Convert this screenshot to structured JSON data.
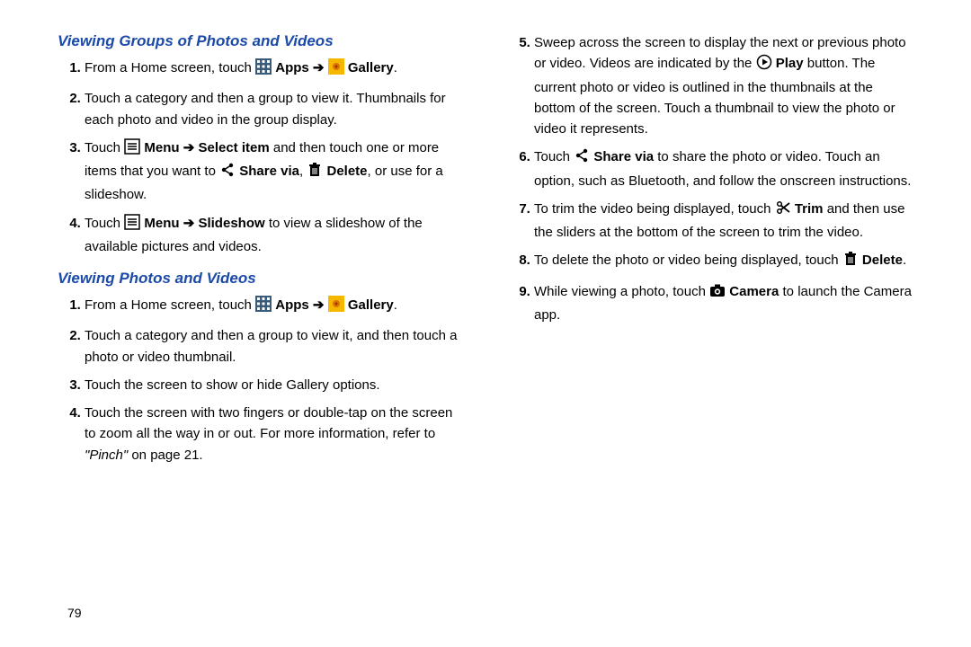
{
  "pageNumber": "79",
  "col1": {
    "heading1": "Viewing Groups of Photos and Videos",
    "s1_i1_a": "From a Home screen, touch ",
    "apps": "Apps",
    "arrow": " ➔ ",
    "gallery": "Gallery",
    "period": ".",
    "s1_i2": "Touch a category and then a group to view it. Thumbnails for each photo and video in the group display.",
    "s1_i3_a": "Touch ",
    "menu": "Menu",
    "select_item": "Select item",
    "s1_i3_b": " and then touch one or more items that you want to ",
    "share_via": "Share via",
    "comma_sp": ", ",
    "delete": "Delete",
    "s1_i3_c": ", or use for a slideshow.",
    "slideshow": "Slideshow",
    "s1_i4_b": " to view a slideshow of the available pictures and videos.",
    "heading2": "Viewing Photos and Videos",
    "s2_i2": "Touch a category and then a group to view it, and then touch a photo or video thumbnail.",
    "s2_i3": "Touch the screen to show or hide Gallery options.",
    "s2_i4_a": "Touch the screen with two fingers or double-tap on the screen to zoom all the way in or out. For more information, refer to ",
    "s2_i4_ref": "\"Pinch\"",
    "s2_i4_b": " on page 21."
  },
  "col2": {
    "i5_a": "Sweep across the screen to display the next or previous photo or video. Videos are indicated by the ",
    "play": "Play",
    "i5_b": " button. The current photo or video is outlined in the thumbnails at the bottom of the screen. Touch a thumbnail to view the photo or video it represents.",
    "i6_a": "Touch ",
    "share_via": "Share via",
    "i6_b": " to share the photo or video. Touch an option, such as Bluetooth, and follow the onscreen instructions.",
    "i7_a": "To trim the video being displayed, touch ",
    "trim": "Trim",
    "i7_b": " and then use the sliders at the bottom of the screen to trim the video.",
    "i8_a": "To delete the photo or video being displayed, touch ",
    "delete": "Delete",
    "i9_a": "While viewing a photo, touch ",
    "camera": "Camera",
    "i9_b": " to launch the Camera app."
  }
}
